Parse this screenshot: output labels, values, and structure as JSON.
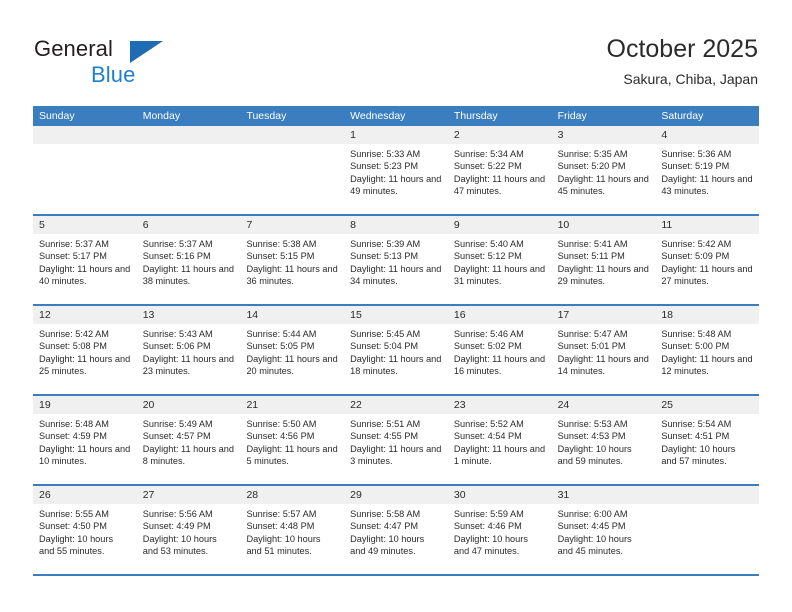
{
  "brand": {
    "name_part1": "General",
    "name_part2": "Blue",
    "triangle_icon": "triangle-icon",
    "accent_color": "#1f6cb4",
    "blue_text_color": "#1f7fd4"
  },
  "header": {
    "title": "October 2025",
    "subtitle": "Sakura, Chiba, Japan"
  },
  "calendar": {
    "header_bg_color": "#3a7ebf",
    "day_band_color": "#f0f0f0",
    "weekdays": [
      "Sunday",
      "Monday",
      "Tuesday",
      "Wednesday",
      "Thursday",
      "Friday",
      "Saturday"
    ],
    "labels": {
      "sunrise": "Sunrise:",
      "sunset": "Sunset:",
      "daylight": "Daylight:"
    },
    "weeks": [
      [
        {
          "day": "",
          "empty": true
        },
        {
          "day": "",
          "empty": true
        },
        {
          "day": "",
          "empty": true
        },
        {
          "day": "1",
          "sunrise": "Sunrise: 5:33 AM",
          "sunset": "Sunset: 5:23 PM",
          "daylight": "Daylight: 11 hours and 49 minutes."
        },
        {
          "day": "2",
          "sunrise": "Sunrise: 5:34 AM",
          "sunset": "Sunset: 5:22 PM",
          "daylight": "Daylight: 11 hours and 47 minutes."
        },
        {
          "day": "3",
          "sunrise": "Sunrise: 5:35 AM",
          "sunset": "Sunset: 5:20 PM",
          "daylight": "Daylight: 11 hours and 45 minutes."
        },
        {
          "day": "4",
          "sunrise": "Sunrise: 5:36 AM",
          "sunset": "Sunset: 5:19 PM",
          "daylight": "Daylight: 11 hours and 43 minutes."
        }
      ],
      [
        {
          "day": "5",
          "sunrise": "Sunrise: 5:37 AM",
          "sunset": "Sunset: 5:17 PM",
          "daylight": "Daylight: 11 hours and 40 minutes."
        },
        {
          "day": "6",
          "sunrise": "Sunrise: 5:37 AM",
          "sunset": "Sunset: 5:16 PM",
          "daylight": "Daylight: 11 hours and 38 minutes."
        },
        {
          "day": "7",
          "sunrise": "Sunrise: 5:38 AM",
          "sunset": "Sunset: 5:15 PM",
          "daylight": "Daylight: 11 hours and 36 minutes."
        },
        {
          "day": "8",
          "sunrise": "Sunrise: 5:39 AM",
          "sunset": "Sunset: 5:13 PM",
          "daylight": "Daylight: 11 hours and 34 minutes."
        },
        {
          "day": "9",
          "sunrise": "Sunrise: 5:40 AM",
          "sunset": "Sunset: 5:12 PM",
          "daylight": "Daylight: 11 hours and 31 minutes."
        },
        {
          "day": "10",
          "sunrise": "Sunrise: 5:41 AM",
          "sunset": "Sunset: 5:11 PM",
          "daylight": "Daylight: 11 hours and 29 minutes."
        },
        {
          "day": "11",
          "sunrise": "Sunrise: 5:42 AM",
          "sunset": "Sunset: 5:09 PM",
          "daylight": "Daylight: 11 hours and 27 minutes."
        }
      ],
      [
        {
          "day": "12",
          "sunrise": "Sunrise: 5:42 AM",
          "sunset": "Sunset: 5:08 PM",
          "daylight": "Daylight: 11 hours and 25 minutes."
        },
        {
          "day": "13",
          "sunrise": "Sunrise: 5:43 AM",
          "sunset": "Sunset: 5:06 PM",
          "daylight": "Daylight: 11 hours and 23 minutes."
        },
        {
          "day": "14",
          "sunrise": "Sunrise: 5:44 AM",
          "sunset": "Sunset: 5:05 PM",
          "daylight": "Daylight: 11 hours and 20 minutes."
        },
        {
          "day": "15",
          "sunrise": "Sunrise: 5:45 AM",
          "sunset": "Sunset: 5:04 PM",
          "daylight": "Daylight: 11 hours and 18 minutes."
        },
        {
          "day": "16",
          "sunrise": "Sunrise: 5:46 AM",
          "sunset": "Sunset: 5:02 PM",
          "daylight": "Daylight: 11 hours and 16 minutes."
        },
        {
          "day": "17",
          "sunrise": "Sunrise: 5:47 AM",
          "sunset": "Sunset: 5:01 PM",
          "daylight": "Daylight: 11 hours and 14 minutes."
        },
        {
          "day": "18",
          "sunrise": "Sunrise: 5:48 AM",
          "sunset": "Sunset: 5:00 PM",
          "daylight": "Daylight: 11 hours and 12 minutes."
        }
      ],
      [
        {
          "day": "19",
          "sunrise": "Sunrise: 5:48 AM",
          "sunset": "Sunset: 4:59 PM",
          "daylight": "Daylight: 11 hours and 10 minutes."
        },
        {
          "day": "20",
          "sunrise": "Sunrise: 5:49 AM",
          "sunset": "Sunset: 4:57 PM",
          "daylight": "Daylight: 11 hours and 8 minutes."
        },
        {
          "day": "21",
          "sunrise": "Sunrise: 5:50 AM",
          "sunset": "Sunset: 4:56 PM",
          "daylight": "Daylight: 11 hours and 5 minutes."
        },
        {
          "day": "22",
          "sunrise": "Sunrise: 5:51 AM",
          "sunset": "Sunset: 4:55 PM",
          "daylight": "Daylight: 11 hours and 3 minutes."
        },
        {
          "day": "23",
          "sunrise": "Sunrise: 5:52 AM",
          "sunset": "Sunset: 4:54 PM",
          "daylight": "Daylight: 11 hours and 1 minute."
        },
        {
          "day": "24",
          "sunrise": "Sunrise: 5:53 AM",
          "sunset": "Sunset: 4:53 PM",
          "daylight": "Daylight: 10 hours and 59 minutes."
        },
        {
          "day": "25",
          "sunrise": "Sunrise: 5:54 AM",
          "sunset": "Sunset: 4:51 PM",
          "daylight": "Daylight: 10 hours and 57 minutes."
        }
      ],
      [
        {
          "day": "26",
          "sunrise": "Sunrise: 5:55 AM",
          "sunset": "Sunset: 4:50 PM",
          "daylight": "Daylight: 10 hours and 55 minutes."
        },
        {
          "day": "27",
          "sunrise": "Sunrise: 5:56 AM",
          "sunset": "Sunset: 4:49 PM",
          "daylight": "Daylight: 10 hours and 53 minutes."
        },
        {
          "day": "28",
          "sunrise": "Sunrise: 5:57 AM",
          "sunset": "Sunset: 4:48 PM",
          "daylight": "Daylight: 10 hours and 51 minutes."
        },
        {
          "day": "29",
          "sunrise": "Sunrise: 5:58 AM",
          "sunset": "Sunset: 4:47 PM",
          "daylight": "Daylight: 10 hours and 49 minutes."
        },
        {
          "day": "30",
          "sunrise": "Sunrise: 5:59 AM",
          "sunset": "Sunset: 4:46 PM",
          "daylight": "Daylight: 10 hours and 47 minutes."
        },
        {
          "day": "31",
          "sunrise": "Sunrise: 6:00 AM",
          "sunset": "Sunset: 4:45 PM",
          "daylight": "Daylight: 10 hours and 45 minutes."
        },
        {
          "day": "",
          "empty": true
        }
      ]
    ]
  }
}
